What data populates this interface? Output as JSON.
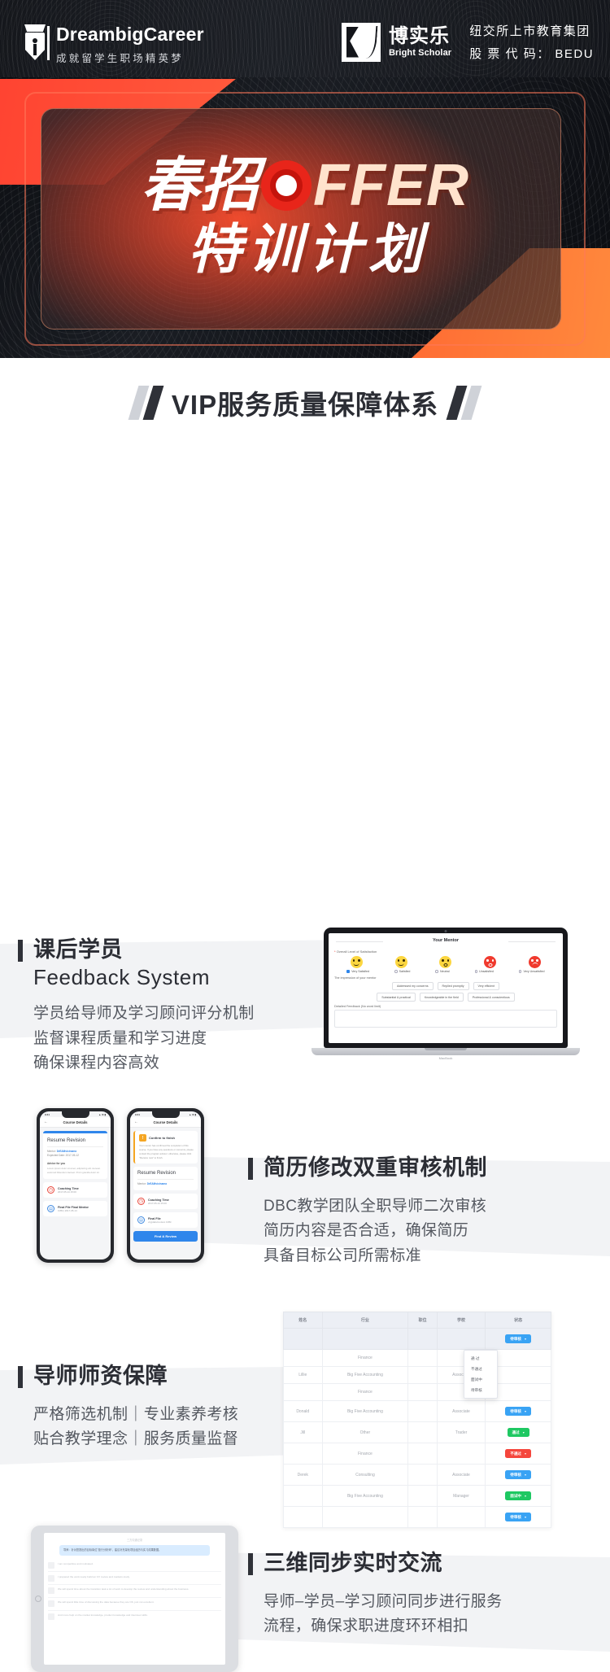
{
  "header": {
    "left_brand": {
      "name": "DreambigCareer",
      "tagline": "成就留学生职场精英梦"
    },
    "right_brand": {
      "cn": "博实乐",
      "en": "Bright Scholar",
      "line1": "纽交所上市教育集团",
      "line2": "股 票 代 码： BEDU"
    }
  },
  "hero": {
    "cn_prefix": "春招",
    "o_letter": "O",
    "ffer": "FFER",
    "line2": "特训计划"
  },
  "section_title": "VIP服务质量保障体系",
  "features": [
    {
      "title_cn": "课后学员",
      "title_en": "Feedback System",
      "desc": [
        "学员给导师及学习顾问评分机制",
        "监督课程质量和学习进度",
        "确保课程内容高效"
      ]
    },
    {
      "title_cn": "简历修改双重审核机制",
      "title_en": "",
      "desc": [
        "DBC教学团队全职导师二次审核",
        "简历内容是否合适，确保简历",
        "具备目标公司所需标准"
      ]
    },
    {
      "title_cn": "导师师资保障",
      "title_en": "",
      "desc": [
        "严格筛选机制｜专业素养考核",
        "贴合教学理念｜服务质量监督"
      ]
    },
    {
      "title_cn": "三维同步实时交流",
      "title_en": "",
      "desc": [
        "导师–学员–学习顾问同步进行服务",
        "流程，确保求职进度环环相扣"
      ]
    }
  ],
  "laptop_mockup": {
    "title": "Your Mentor",
    "question": "Overall Level of Satisfaction",
    "required_mark": "*",
    "ratings": [
      {
        "label": "Very Satisfied",
        "selected": true
      },
      {
        "label": "Satisfied",
        "selected": false
      },
      {
        "label": "Neutral",
        "selected": false
      },
      {
        "label": "Unsatisfied",
        "selected": false
      },
      {
        "label": "Very Unsatisfied",
        "selected": false
      }
    ],
    "impression_label": "The impression of your mentor",
    "tags_row1": [
      "Addressed my concerns",
      "Replied promptly",
      "Very efficient"
    ],
    "tags_row2": [
      "Substantial & practical",
      "Knowledgeable in the field",
      "Professional & conscientious"
    ],
    "feedback_label": "Detailed Feedback (No word limit)",
    "device_label": "MacBook"
  },
  "phone_mockups": {
    "left": {
      "status_time": "9:41",
      "nav_title": "Course Details",
      "back_icon": "←",
      "card_title": "Resume Revision",
      "mentor_label": "Mentor:",
      "mentor_name": "DrEAMvicinama",
      "date_label": "Expected Date: 2017-05-12",
      "advice_label": "Advice for you",
      "advice_text": "Lorem ipsum dolor sit amet, adipiscing elit. Aenean euismod bibendum laoreet. Proin gravida dolor sit",
      "items": [
        {
          "title": "Coaching Time",
          "sub": "2017-05-14 15:00"
        },
        {
          "title": "Final File Final Mentor",
          "sub": "0.8M | 2017-05-14"
        }
      ]
    },
    "right": {
      "status_time": "9:41",
      "nav_title": "Course Details",
      "back_icon": "←",
      "notice_title": "Confirm to finish",
      "notice_text": "Your mentor has confirmed the completion of this course. If you have any questions or concerns, please contact the program advisor; otherwise, please click \"Receive now\" to finish.",
      "card_title": "Resume Revision",
      "mentor_label": "Mentor:",
      "mentor_name": "DrEAMvicinama",
      "items": [
        {
          "title": "Coaching Time",
          "sub": "2017-05-14 15:00"
        },
        {
          "title": "Final File",
          "sub": "vriyjdabvrw.docx 0.8M"
        }
      ],
      "button_label": "Find & Review"
    }
  },
  "table_mockup": {
    "columns": [
      "姓名",
      "行业",
      "职位",
      "学校",
      "状态"
    ],
    "rows": [
      {
        "name": "",
        "industry": "Finance",
        "role": "",
        "school": "",
        "status": "待审核",
        "status_color": "blue"
      },
      {
        "name": "Lillie",
        "industry": "Big Five Accounting",
        "role": "",
        "school": "Associate",
        "status": "",
        "status_color": ""
      },
      {
        "name": "",
        "industry": "Finance",
        "role": "",
        "school": "",
        "status": "",
        "status_color": ""
      },
      {
        "name": "Donald",
        "industry": "Big Five Accounting",
        "role": "",
        "school": "Associate",
        "status": "待审核",
        "status_color": "blue"
      },
      {
        "name": "Jill",
        "industry": "Other",
        "role": "",
        "school": "Trader",
        "status": "通过",
        "status_color": "green"
      },
      {
        "name": "",
        "industry": "Finance",
        "role": "",
        "school": "",
        "status": "不通过",
        "status_color": "red"
      },
      {
        "name": "Derek",
        "industry": "Consulting",
        "role": "",
        "school": "Associate",
        "status": "待审核",
        "status_color": "blue"
      },
      {
        "name": "",
        "industry": "Big Five Accounting",
        "role": "",
        "school": "Manager",
        "status": "面试中",
        "status_color": "green"
      },
      {
        "name": "",
        "industry": "",
        "role": "",
        "school": "",
        "status": "待审核",
        "status_color": "blue"
      }
    ],
    "filter_badge": "待审核",
    "dropdown_options": [
      "通 过",
      "不通过",
      "面试中",
      "待审核"
    ],
    "caret_icon": "▾"
  },
  "tablet_mockup": {
    "header": "三方沟通记录",
    "quote": "导师：针对您提出的目标岗位\"投行分析师\"，建议补充量化项目经历与实习成果数据。",
    "lines": [
      "I am competitive and motivated.",
      "I prepared the work ready build an CV review and markets study.",
      "We will spend time about the transition task a lot of work to develop the review and understanding about the business.",
      "We will spend little time of discussing the data because they are OK, just not excellent.",
      "And more help on the market knowledge, product knowledge and interview skills."
    ]
  }
}
